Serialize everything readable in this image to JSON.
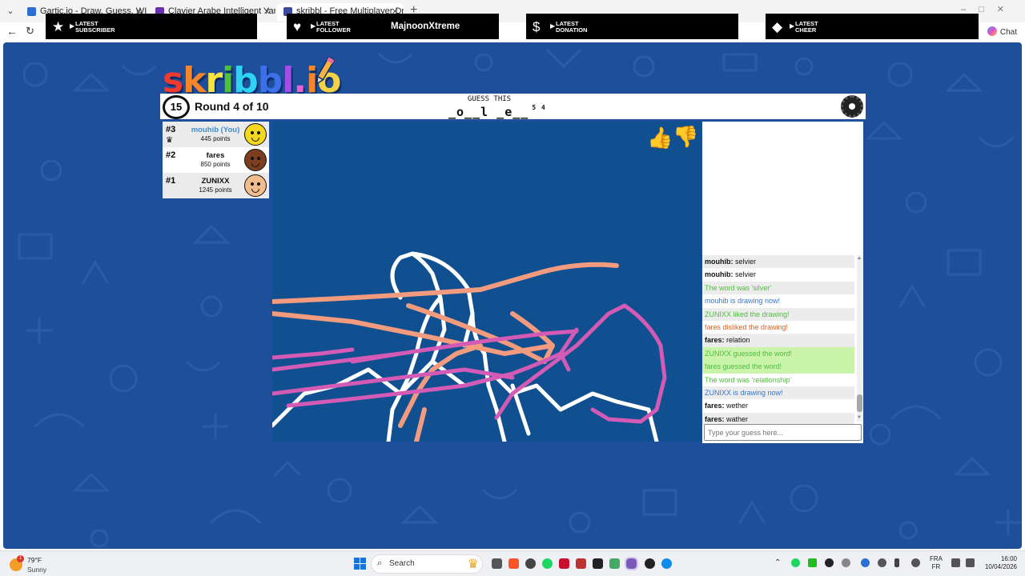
{
  "browser": {
    "tabs": [
      {
        "title": "Gartic.io - Draw, Guess, WIN",
        "favicon_color": "#2a6fd1",
        "active": false
      },
      {
        "title": "Clavier Arabe Intelligent Yamli™",
        "favicon_color": "#6b2fb3",
        "active": false
      },
      {
        "title": "skribbl - Free Multiplayer Drawin",
        "favicon_color": "#3b4a9c",
        "active": true
      }
    ],
    "chat_label": "Chat"
  },
  "stream_overlay": [
    {
      "icon": "star-icon",
      "label_line1": "LATEST",
      "label_line2": "SUBSCRIBER",
      "value": ""
    },
    {
      "icon": "heart-icon",
      "label_line1": "LATEST",
      "label_line2": "FOLLOWER",
      "value": "MajnoonXtreme"
    },
    {
      "icon": "dollar-icon",
      "label_line1": "LATEST",
      "label_line2": "DONATION",
      "value": ""
    },
    {
      "icon": "diamond-icon",
      "label_line1": "LATEST",
      "label_line2": "CHEER",
      "value": ""
    }
  ],
  "game": {
    "logo_letters": [
      {
        "ch": "s",
        "color": "#ef3b2d"
      },
      {
        "ch": "k",
        "color": "#f7862a"
      },
      {
        "ch": "r",
        "color": "#fbe43b"
      },
      {
        "ch": "i",
        "color": "#4fc134"
      },
      {
        "ch": "b",
        "color": "#2ed2f2"
      },
      {
        "ch": "b",
        "color": "#3d70e6"
      },
      {
        "ch": "l",
        "color": "#a44ee9"
      },
      {
        "ch": ".",
        "color": "#f05fcf"
      },
      {
        "ch": "i",
        "color": "#f7862a"
      },
      {
        "ch": "o",
        "color": "#f5d243"
      }
    ],
    "timer": "15",
    "round_text": "Round 4 of 10",
    "guess_label": "GUESS THIS",
    "word_hint": "_o__l _e__",
    "word_lengths": "5 4",
    "players": [
      {
        "rank": "#3",
        "name": "mouhib (You)",
        "points": "445 points",
        "is_you": true,
        "skin": "#f4d71f",
        "crown": true
      },
      {
        "rank": "#2",
        "name": "fares",
        "points": "850 points",
        "is_you": false,
        "skin": "#7b3f1f",
        "crown": false
      },
      {
        "rank": "#1",
        "name": "ZUNIXX",
        "points": "1245 points",
        "is_you": false,
        "skin": "#f2bd8c",
        "crown": false
      }
    ],
    "chat": [
      {
        "name": "mouhib:",
        "text": " selvier",
        "style": "plain",
        "alt": true
      },
      {
        "name": "mouhib:",
        "text": " selvier",
        "style": "plain",
        "alt": false
      },
      {
        "name": "",
        "text": "The word was 'silver'",
        "style": "green",
        "alt": true
      },
      {
        "name": "",
        "text": "mouhib is drawing now!",
        "style": "blue",
        "alt": false
      },
      {
        "name": "",
        "text": "ZUNIXX liked the drawing!",
        "style": "green",
        "alt": true
      },
      {
        "name": "",
        "text": "fares disliked the drawing!",
        "style": "orange",
        "alt": false
      },
      {
        "name": "fares:",
        "text": " relation",
        "style": "plain",
        "alt": true
      },
      {
        "name": "",
        "text": "ZUNIXX guessed the word!",
        "style": "gbg",
        "alt": false
      },
      {
        "name": "",
        "text": "fares guessed the word!",
        "style": "gbg",
        "alt": false
      },
      {
        "name": "",
        "text": "The word was 'relationship'",
        "style": "green",
        "alt": false
      },
      {
        "name": "",
        "text": "ZUNIXX is drawing now!",
        "style": "blue",
        "alt": true
      },
      {
        "name": "fares:",
        "text": " wether",
        "style": "plain",
        "alt": false
      },
      {
        "name": "fares:",
        "text": " wather",
        "style": "plain",
        "alt": true
      }
    ],
    "guess_placeholder": "Type your guess here..."
  },
  "taskbar": {
    "weather_temp": "79°F",
    "weather_condition": "Sunny",
    "weather_badge": "1",
    "search_label": "Search",
    "lang_line1": "FRA",
    "lang_line2": "FR",
    "time": "16:00",
    "date": "10/04/2026"
  }
}
